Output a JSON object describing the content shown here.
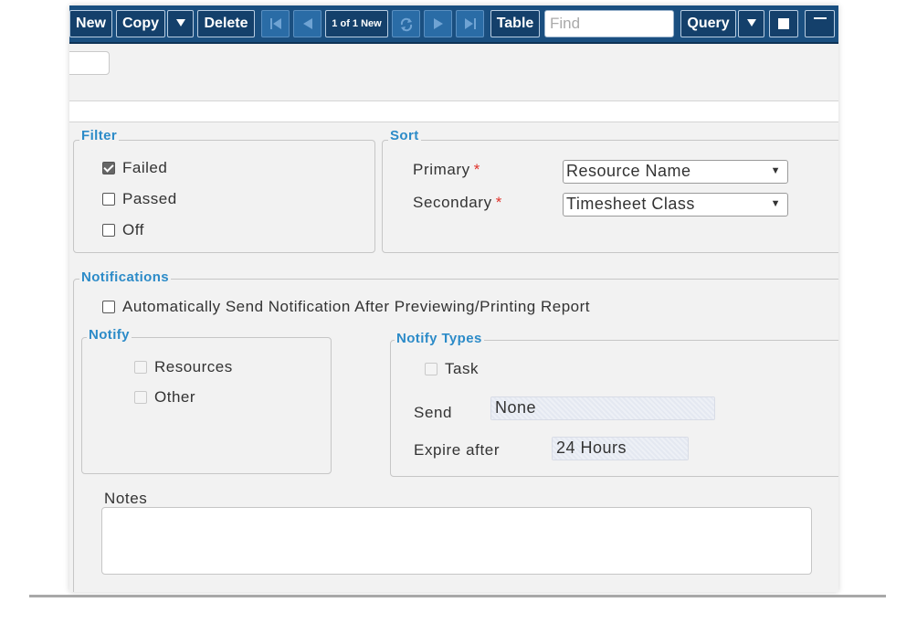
{
  "toolbar": {
    "new": "New",
    "copy": "Copy",
    "delete": "Delete",
    "record_counter": "1 of 1 New",
    "table": "Table",
    "find_placeholder": "Find",
    "query": "Query",
    "icons": {
      "copy_dropdown": "caret-down-icon",
      "first": "first-record-icon",
      "previous": "previous-record-icon",
      "refresh": "refresh-icon",
      "next": "next-record-icon",
      "last": "last-record-icon",
      "query_dropdown": "caret-down-icon",
      "maximize": "maximize-icon",
      "minimize": "minimize-icon"
    }
  },
  "filter": {
    "legend": "Filter",
    "options": [
      {
        "label": "Failed",
        "checked": true
      },
      {
        "label": "Passed",
        "checked": false
      },
      {
        "label": "Off",
        "checked": false
      }
    ]
  },
  "sort": {
    "legend": "Sort",
    "primary_label": "Primary",
    "primary_value": "Resource Name",
    "secondary_label": "Secondary",
    "secondary_value": "Timesheet Class",
    "required_marker": "*"
  },
  "notifications": {
    "legend": "Notifications",
    "auto_send_label": "Automatically Send Notification After Previewing/Printing Report",
    "auto_send_checked": false,
    "notify": {
      "legend": "Notify",
      "resources_label": "Resources",
      "other_label": "Other"
    },
    "notify_types": {
      "legend": "Notify Types",
      "task_label": "Task",
      "send_label": "Send",
      "send_value": "None",
      "expire_label": "Expire after",
      "expire_value": "24 Hours"
    },
    "notes_label": "Notes"
  },
  "colors": {
    "toolbar_bg": "#1a4f80",
    "legend": "#2c8bc8",
    "required": "#e0332b",
    "panel_bg": "#f2f2f2"
  }
}
